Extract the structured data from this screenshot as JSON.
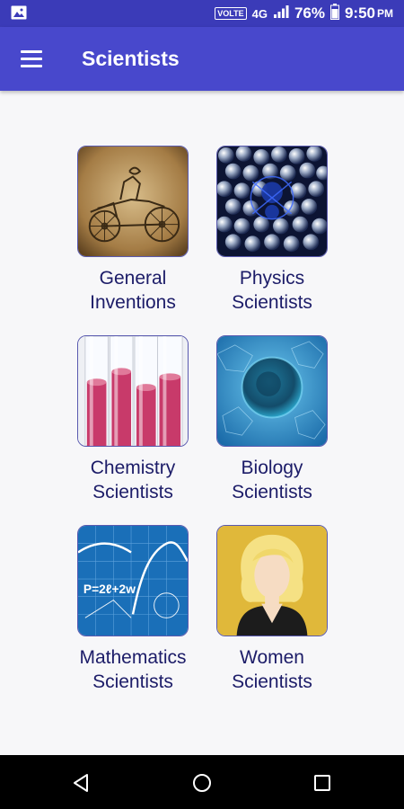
{
  "status_bar": {
    "volte": "VOLTE",
    "network": "4G",
    "battery": "76%",
    "time": "9:50",
    "ampm": "PM"
  },
  "app_bar": {
    "title": "Scientists"
  },
  "categories": [
    {
      "line1": "General",
      "line2": "Inventions",
      "icon": "vintage-car-image"
    },
    {
      "line1": "Physics",
      "line2": "Scientists",
      "icon": "molecule-image"
    },
    {
      "line1": "Chemistry",
      "line2": "Scientists",
      "icon": "test-tubes-image"
    },
    {
      "line1": "Biology",
      "line2": "Scientists",
      "icon": "cell-image"
    },
    {
      "line1": "Mathematics",
      "line2": "Scientists",
      "icon": "formula-image"
    },
    {
      "line1": "Women",
      "line2": "Scientists",
      "icon": "woman-avatar-image"
    }
  ],
  "colors": {
    "status_bar": "#3b3bb8",
    "app_bar": "#4848cc",
    "caption_text": "#1c1c68",
    "background": "#f7f7f9"
  }
}
